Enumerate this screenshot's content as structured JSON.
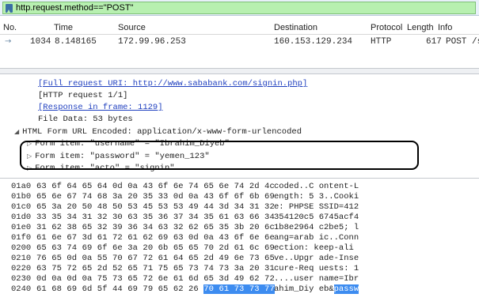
{
  "filter": {
    "expression": "http.request.method==\"POST\""
  },
  "packet_list": {
    "columns": [
      "No.",
      "Time",
      "Source",
      "Destination",
      "Protocol",
      "Length",
      "Info"
    ],
    "row": {
      "no": "1034",
      "time": "8.148165",
      "source": "172.99.96.253",
      "destination": "160.153.129.234",
      "protocol": "HTTP",
      "length": "617",
      "info": "POST /sign"
    }
  },
  "details": {
    "full_uri": "[Full request URI: http://www.sababank.com/signin.php]",
    "http_request": "[HTTP request 1/1]",
    "response_in_frame": "[Response in frame: 1129]",
    "file_data": "File Data: 53 bytes",
    "form_section": "HTML Form URL Encoded: application/x-www-form-urlencoded",
    "form_items": [
      "Form item: \"username\" = \"Ibrahim_Diyeb\"",
      "Form item: \"password\" = \"yemen_123\"",
      "Form item: \"acto\" = \"signin\""
    ]
  },
  "bytes": [
    {
      "offset": "01a0",
      "hex": "63 6f 64 65 64 0d 0a 43  6f 6e 74 65 6e 74 2d 4c",
      "ascii": "coded..C ontent-L"
    },
    {
      "offset": "01b0",
      "hex": "65 6e 67 74 68 3a 20 35  33 0d 0a 43 6f 6f 6b 69",
      "ascii": "ength: 5 3..Cooki"
    },
    {
      "offset": "01c0",
      "hex": "65 3a 20 50 48 50 53 45  53 53 49 44 3d 34 31 32",
      "ascii": "e: PHPSE SSID=412"
    },
    {
      "offset": "01d0",
      "hex": "33 35 34 31 32 30 63 35  36 37 34 35 61 63 66 34",
      "ascii": "354120c5 6745acf4"
    },
    {
      "offset": "01e0",
      "hex": "31 62 38 65 32 39 36 34  63 32 62 65 35 3b 20 6c",
      "ascii": "1b8e2964 c2be5; l"
    },
    {
      "offset": "01f0",
      "hex": "61 6e 67 3d 61 72 61 62  69 63 0d 0a 43 6f 6e 6e",
      "ascii": "ang=arab ic..Conn"
    },
    {
      "offset": "0200",
      "hex": "65 63 74 69 6f 6e 3a 20  6b 65 65 70 2d 61 6c 69",
      "ascii": "ection:  keep-ali"
    },
    {
      "offset": "0210",
      "hex": "76 65 0d 0a 55 70 67 72  61 64 65 2d 49 6e 73 65",
      "ascii": "ve..Upgr ade-Inse"
    },
    {
      "offset": "0220",
      "hex": "63 75 72 65 2d 52 65 71  75 65 73 74 73 3a 20 31",
      "ascii": "cure-Req uests: 1"
    },
    {
      "offset": "0230",
      "hex": "0d 0a 0d 0a 75 73 65 72  6e 61 6d 65 3d 49 62 72",
      "ascii": "....user name=Ibr"
    },
    {
      "offset": "0240",
      "hex": "61 68 69 6d 5f 44 69 79  65 62 26",
      "hex_selected": "70 61 73 73 77",
      "ascii": "ahim_Diy eb&",
      "ascii_selected": "passw"
    }
  ]
}
